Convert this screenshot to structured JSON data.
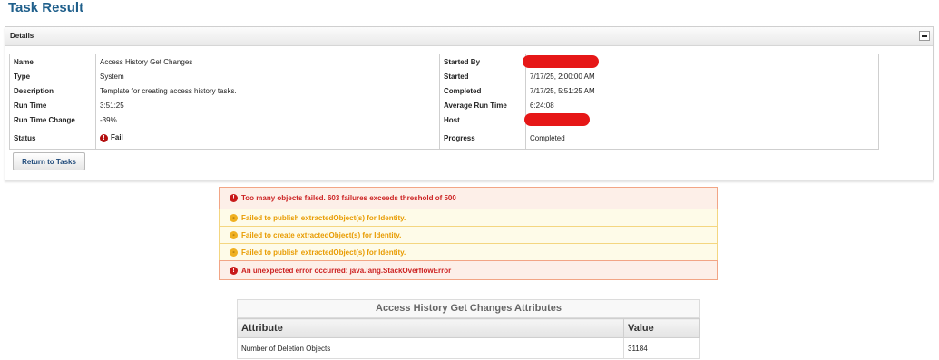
{
  "page": {
    "title": "Task Result"
  },
  "details_panel": {
    "title": "Details",
    "collapse_icon": "minus-icon",
    "rows": [
      {
        "label": "Name",
        "value": "Access History Get Changes",
        "label2": "Started By",
        "value2": "",
        "value2_redacted": true
      },
      {
        "label": "Type",
        "value": "System",
        "label2": "Started",
        "value2": "7/17/25, 2:00:00 AM"
      },
      {
        "label": "Description",
        "value": "Template for creating access history tasks.",
        "label2": "Completed",
        "value2": "7/17/25, 5:51:25 AM"
      },
      {
        "label": "Run Time",
        "value": "3:51:25",
        "label2": "Average Run Time",
        "value2": "6:24:08"
      },
      {
        "label": "Run Time Change",
        "value": "-39%",
        "label2": "Host",
        "value2": "",
        "value2_redacted": true
      },
      {
        "label": "Status",
        "value": "Fail",
        "status_icon": "error-icon",
        "label2": "Progress",
        "value2": "Completed"
      }
    ],
    "return_button": "Return to Tasks"
  },
  "messages": [
    {
      "type": "error",
      "icon": "error-icon",
      "text": "Too many objects failed. 603 failures exceeds threshold of 500"
    },
    {
      "type": "warning",
      "icon": "warning-icon",
      "text": "Failed to publish extractedObject(s) for Identity."
    },
    {
      "type": "warning",
      "icon": "warning-icon",
      "text": "Failed to create extractedObject(s) for Identity."
    },
    {
      "type": "warning",
      "icon": "warning-icon",
      "text": "Failed to publish extractedObject(s) for Identity."
    },
    {
      "type": "error",
      "icon": "error-icon",
      "text": "An unexpected error occurred: java.lang.StackOverflowError"
    }
  ],
  "attributes": {
    "title": "Access History Get Changes Attributes",
    "headers": [
      "Attribute",
      "Value"
    ],
    "rows": [
      {
        "attribute": "Number of Deletion Objects",
        "value": "31184"
      }
    ]
  },
  "colors": {
    "title": "#1f5f8b",
    "error_text": "#cc2222",
    "warning_text": "#e89b00",
    "redaction": "#e61717"
  }
}
